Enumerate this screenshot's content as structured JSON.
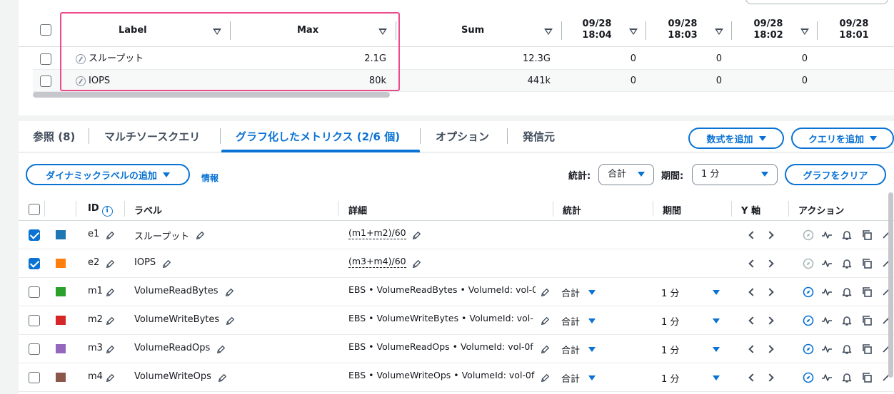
{
  "legend_table": {
    "headers": {
      "label": "Label",
      "max": "Max",
      "sum": "Sum"
    },
    "date_columns": [
      {
        "date": "09/28",
        "time": "18:04"
      },
      {
        "date": "09/28",
        "time": "18:03"
      },
      {
        "date": "09/28",
        "time": "18:02"
      },
      {
        "date": "09/28",
        "time": "18:01"
      }
    ],
    "rows": [
      {
        "label": "スループット",
        "max": "2.1G",
        "sum": "12.3G",
        "v1": "0",
        "v2": "0",
        "v3": "0"
      },
      {
        "label": "IOPS",
        "max": "80k",
        "sum": "441k",
        "v1": "0",
        "v2": "0",
        "v3": "0"
      }
    ]
  },
  "tabs": {
    "items": [
      "参照 (8)",
      "マルチソースクエリ",
      "グラフ化したメトリクス (2/6 個)",
      "オプション",
      "発信元"
    ],
    "add_formula": "数式を追加",
    "add_query": "クエリを追加"
  },
  "toolbar": {
    "dynamic_label": "ダイナミックラベルの追加",
    "info": "情報",
    "stat_label": "統計:",
    "stat_value": "合計",
    "period_label": "期間:",
    "period_value": "1 分",
    "clear_graph": "グラフをクリア"
  },
  "metrics_table": {
    "headers": {
      "id": "ID",
      "label": "ラベル",
      "details": "詳細",
      "stat": "統計",
      "period": "期間",
      "y_axis": "Y 軸",
      "actions": "アクション"
    },
    "rows": [
      {
        "id": "e1",
        "label": "スループット",
        "details": "(m1+m2)/60",
        "stat": "",
        "period": "",
        "color": "#1f77b4",
        "checked": true
      },
      {
        "id": "e2",
        "label": "IOPS",
        "details": "(m3+m4)/60",
        "stat": "",
        "period": "",
        "color": "#ff7f0e",
        "checked": true
      },
      {
        "id": "m1",
        "label": "VolumeReadBytes",
        "details": "EBS • VolumeReadBytes • VolumeId: vol-0",
        "stat": "合計",
        "period": "1 分",
        "color": "#2ca02c",
        "checked": false
      },
      {
        "id": "m2",
        "label": "VolumeWriteBytes",
        "details": "EBS • VolumeWriteBytes • VolumeId: vol-",
        "stat": "合計",
        "period": "1 分",
        "color": "#d62728",
        "checked": false
      },
      {
        "id": "m3",
        "label": "VolumeReadOps",
        "details": "EBS • VolumeReadOps • VolumeId: vol-0f",
        "stat": "合計",
        "period": "1 分",
        "color": "#9467bd",
        "checked": false
      },
      {
        "id": "m4",
        "label": "VolumeWriteOps",
        "details": "EBS • VolumeWriteOps • VolumeId: vol-0f",
        "stat": "合計",
        "period": "1 分",
        "color": "#8c564b",
        "checked": false
      }
    ]
  },
  "colors": {
    "accent": "#0972d3",
    "highlight": "#ec4b8d"
  }
}
